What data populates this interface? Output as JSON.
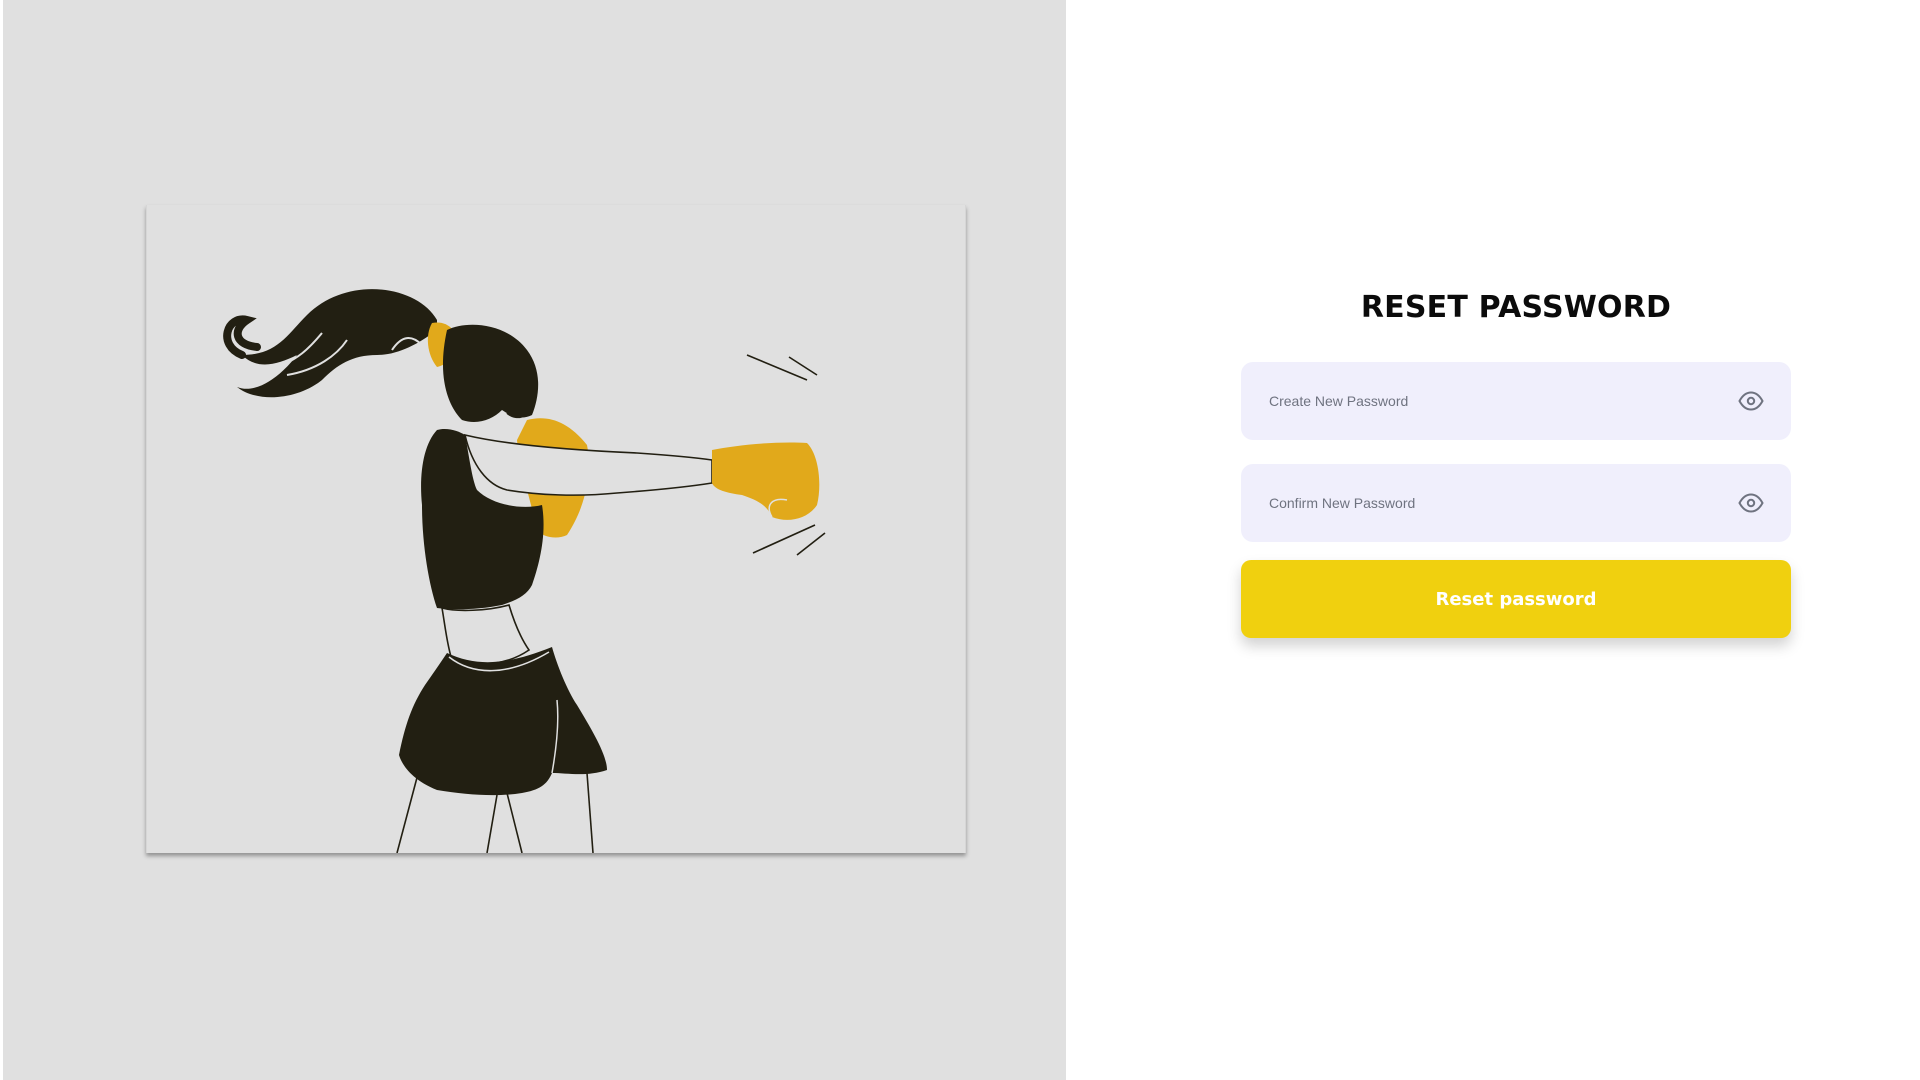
{
  "colors": {
    "left_panel_bg": "#e0e0e0",
    "field_bg": "#f0effc",
    "accent_yellow": "#f0d00f",
    "glove_yellow": "#e1a91b",
    "figure_dark": "#221f12"
  },
  "illustration": {
    "icon": "boxer-woman-illustration"
  },
  "form": {
    "title": "RESET PASSWORD",
    "new_password": {
      "placeholder": "Create New Password",
      "value": "",
      "icon": "eye-icon"
    },
    "confirm_password": {
      "placeholder": "Confirm New Password",
      "value": "",
      "icon": "eye-icon"
    },
    "submit_label": "Reset password"
  }
}
